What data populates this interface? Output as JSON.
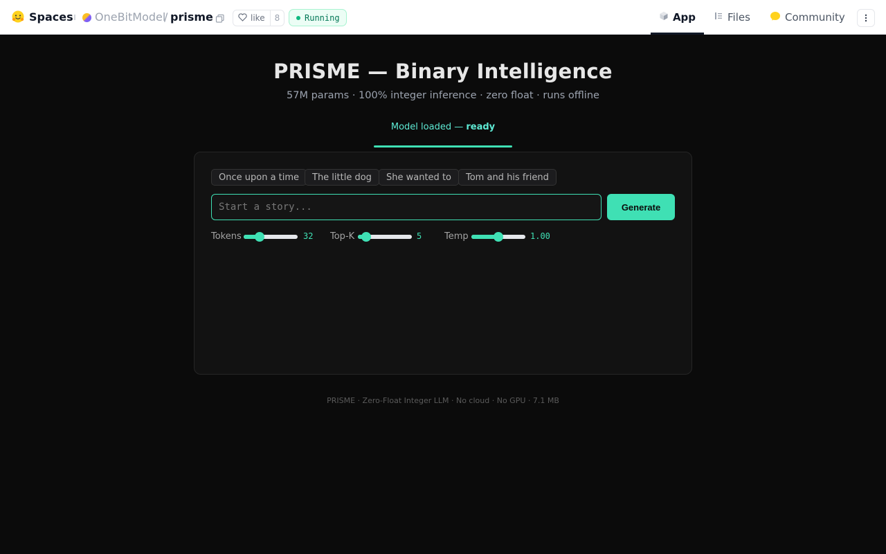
{
  "header": {
    "brand_label": "Spaces",
    "org_name": "OneBitModel",
    "separator": "/",
    "space_name": "prisme",
    "like_label": "like",
    "like_count": "8",
    "status_label": "Running",
    "nav": [
      {
        "label": "App",
        "icon": "cube-icon",
        "active": true
      },
      {
        "label": "Files",
        "icon": "files-icon",
        "active": false
      },
      {
        "label": "Community",
        "icon": "community-icon",
        "active": false
      }
    ]
  },
  "main": {
    "title": "PRISME — Binary Intelligence",
    "subtitle": "57M params · 100% integer inference · zero float · runs offline",
    "model_status_prefix": "Model loaded — ",
    "model_status_value": "ready",
    "prompt_chips": [
      "Once upon a time",
      "The little dog",
      "She wanted to",
      "Tom and his friend"
    ],
    "input_placeholder": "Start a story...",
    "input_value": "",
    "generate_label": "Generate",
    "sliders": [
      {
        "label": "Tokens",
        "value": "32",
        "fraction": 0.25
      },
      {
        "label": "Top-K",
        "value": "5",
        "fraction": 0.08
      },
      {
        "label": "Temp",
        "value": "1.00",
        "fraction": 0.5
      }
    ],
    "footer": "PRISME · Zero-Float Integer LLM · No cloud · No GPU · 7.1 MB"
  },
  "colors": {
    "accent": "#3fe0b4",
    "background": "#0b0b0b",
    "status_green": "#10b981"
  }
}
